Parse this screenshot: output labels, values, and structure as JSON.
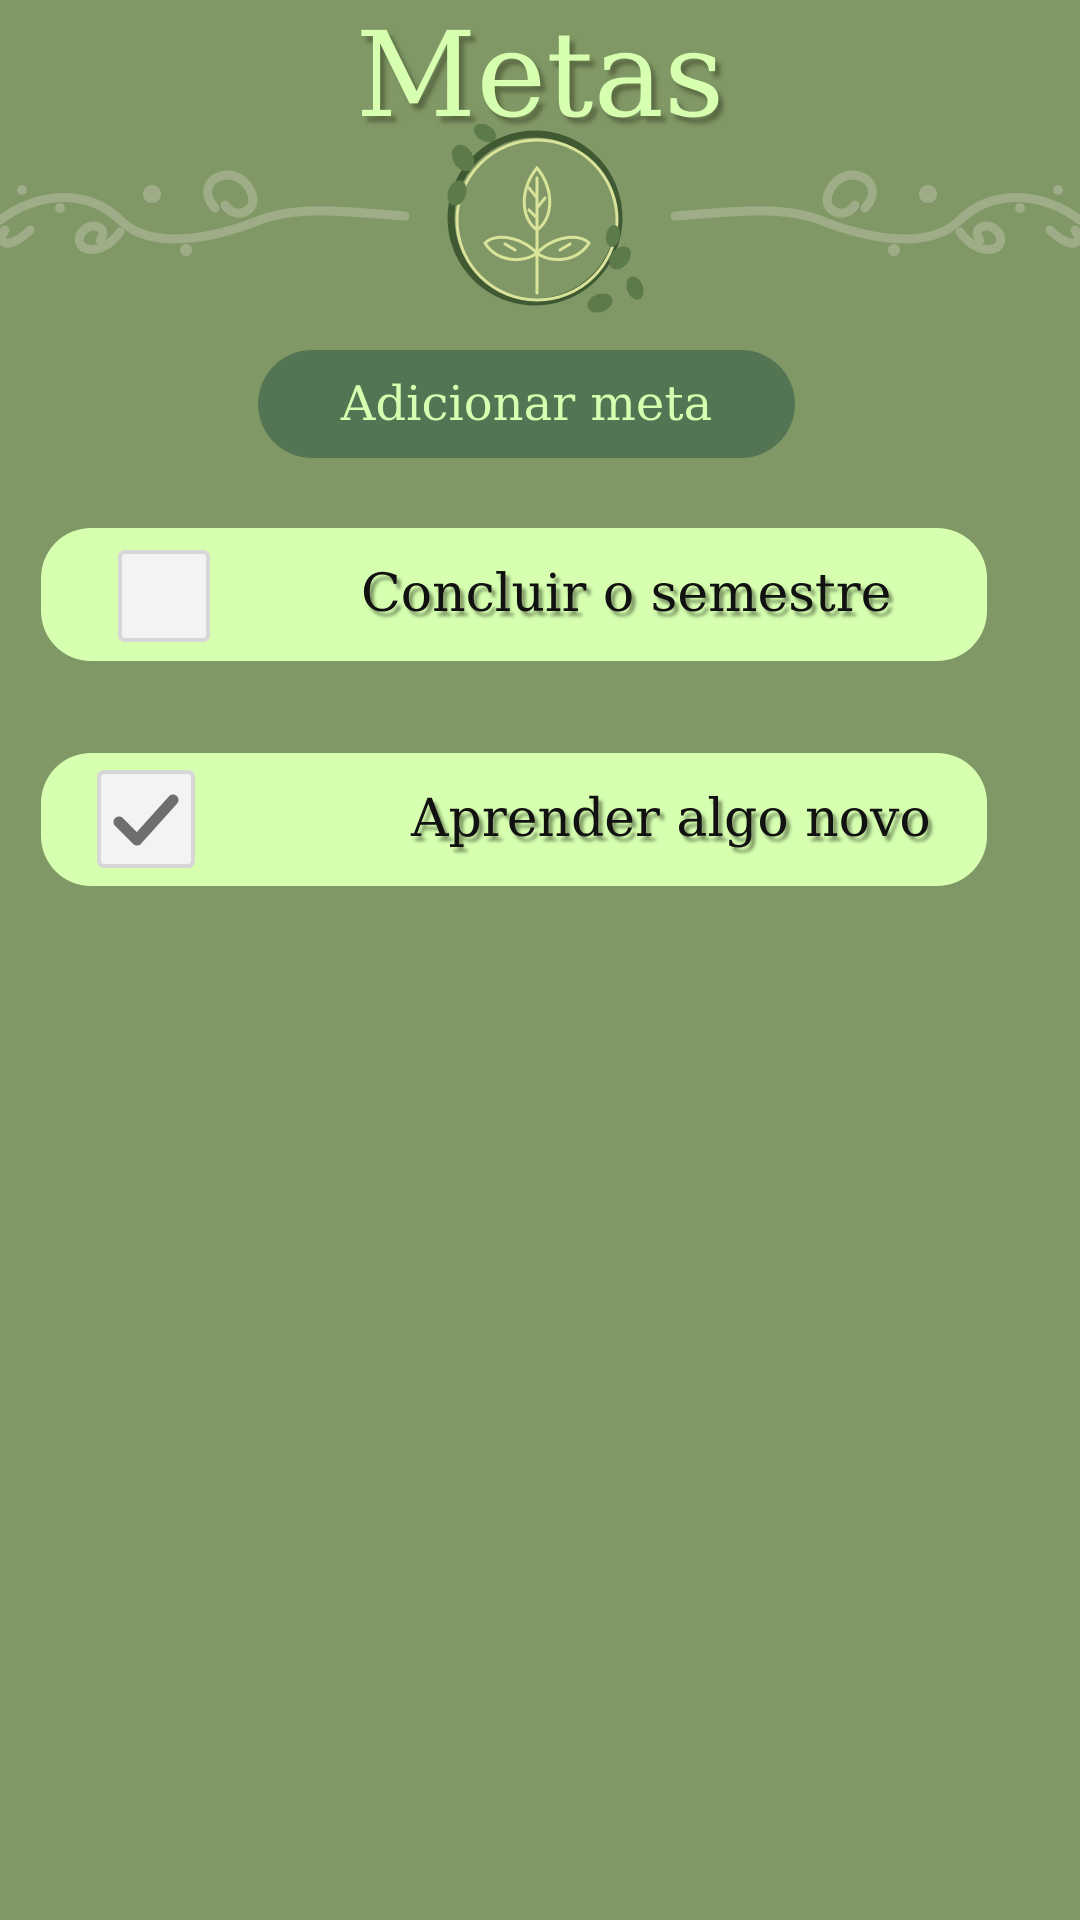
{
  "header": {
    "title": "Metas"
  },
  "actions": {
    "add_goal_label": "Adicionar meta"
  },
  "goals": [
    {
      "label": "Concluir o semestre",
      "checked": false
    },
    {
      "label": "Aprender algo novo",
      "checked": true
    }
  ],
  "icons": {
    "emblem": "plant-emblem-icon",
    "ornament_left": "swirl-ornament-icon",
    "ornament_right": "swirl-ornament-icon",
    "checkmark": "checkmark-icon"
  },
  "colors": {
    "background": "#809865",
    "accent_light": "#d6ffb0",
    "button": "#547553",
    "text_dark": "#111111"
  }
}
